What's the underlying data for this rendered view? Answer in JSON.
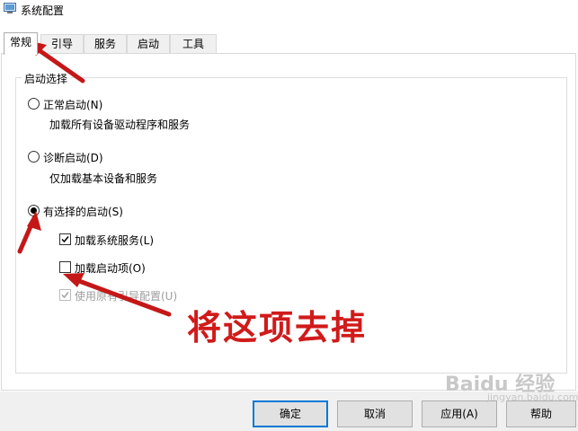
{
  "window": {
    "title": "系统配置",
    "icon": "msconfig-icon"
  },
  "tabs": [
    {
      "label": "常规",
      "active": true
    },
    {
      "label": "引导",
      "active": false
    },
    {
      "label": "服务",
      "active": false
    },
    {
      "label": "启动",
      "active": false
    },
    {
      "label": "工具",
      "active": false
    }
  ],
  "startup": {
    "group_label": "启动选择",
    "options": [
      {
        "label": "正常启动(N)",
        "desc": "加载所有设备驱动程序和服务",
        "selected": false
      },
      {
        "label": "诊断启动(D)",
        "desc": "仅加载基本设备和服务",
        "selected": false
      },
      {
        "label": "有选择的启动(S)",
        "selected": true
      }
    ],
    "checkboxes": [
      {
        "label": "加载系统服务(L)",
        "checked": true,
        "enabled": true
      },
      {
        "label": "加载启动项(O)",
        "checked": false,
        "enabled": true
      },
      {
        "label": "使用原有引导配置(U)",
        "checked": true,
        "enabled": false
      }
    ]
  },
  "buttons": {
    "ok": "确定",
    "cancel": "取消",
    "apply": "应用(A)",
    "help": "帮助"
  },
  "annotation": {
    "text": "将这项去掉",
    "color": "#d11a1a"
  },
  "watermark": {
    "text": "Baidu 经验",
    "sub": "jingyan.baidu.com"
  }
}
